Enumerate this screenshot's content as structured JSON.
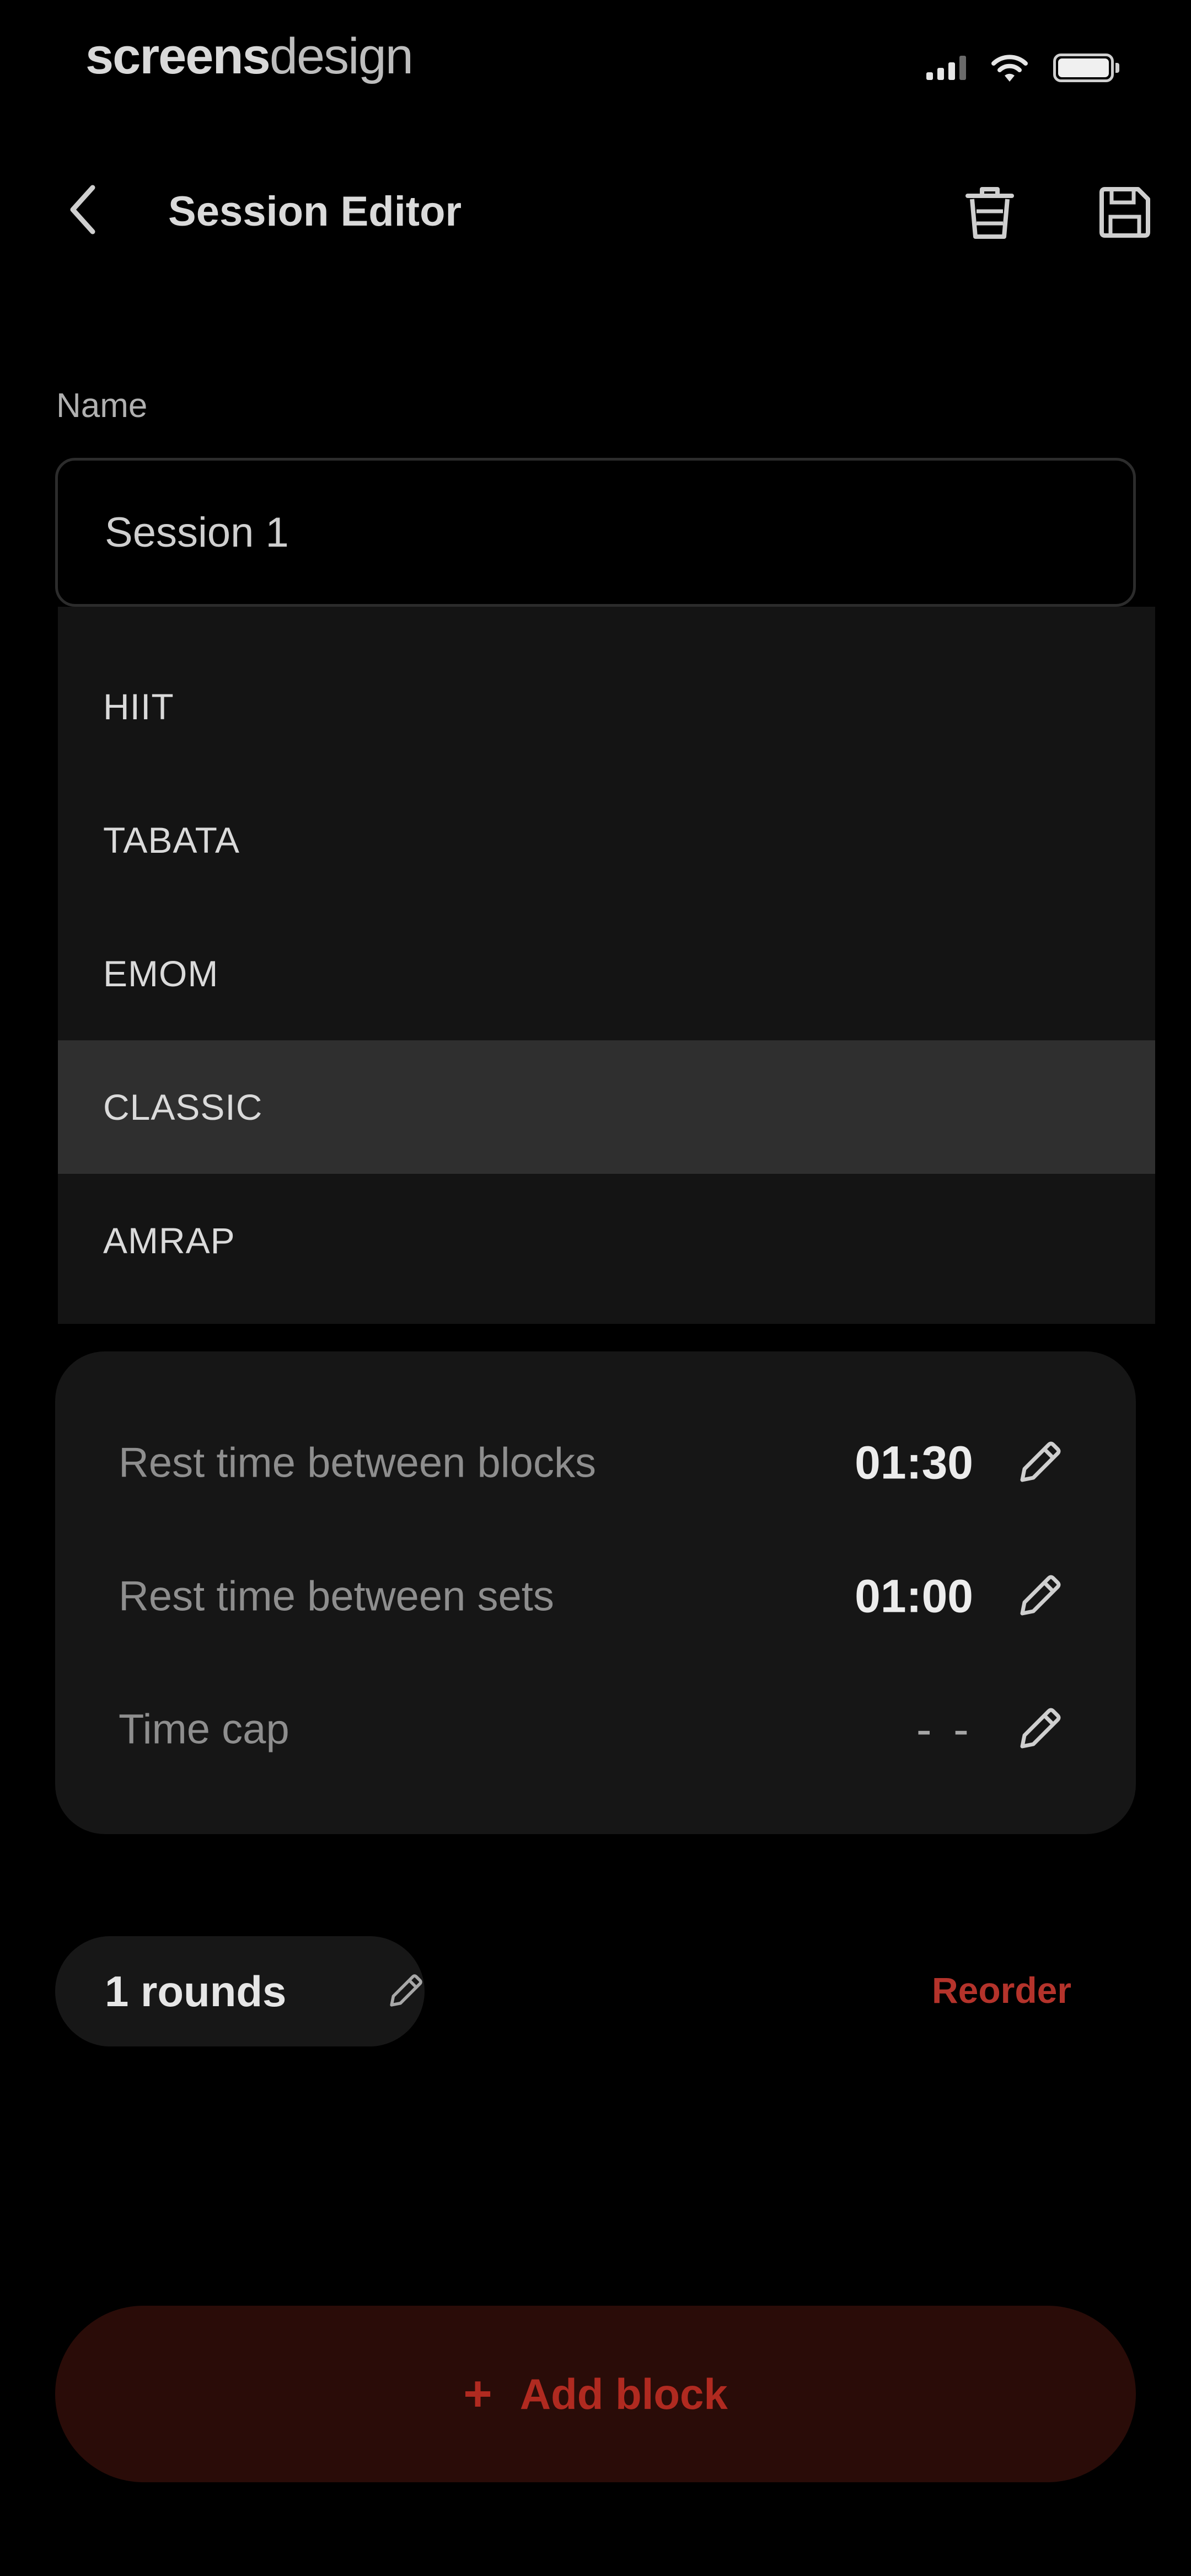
{
  "status_bar": {
    "carrier_bold": "screens",
    "carrier_light": "design",
    "icons": [
      "signal-icon",
      "wifi-icon",
      "battery-icon"
    ]
  },
  "header": {
    "title": "Session Editor",
    "icons": [
      "back-chevron-icon",
      "trash-icon",
      "save-icon"
    ]
  },
  "name_field": {
    "label": "Name",
    "value": "Session 1"
  },
  "workout_type_dropdown": {
    "options": [
      "HIIT",
      "TABATA",
      "EMOM",
      "CLASSIC",
      "AMRAP"
    ],
    "selected": "CLASSIC"
  },
  "settings": [
    {
      "label": "Rest time between blocks",
      "value": "01:30"
    },
    {
      "label": "Rest time between sets",
      "value": "01:00"
    },
    {
      "label": "Time cap",
      "value": "- -"
    }
  ],
  "rounds": {
    "label": "1 rounds"
  },
  "reorder_label": "Reorder",
  "add_block": {
    "plus": "+",
    "label": "Add block"
  },
  "colors": {
    "background": "#000000",
    "card": "#161616",
    "dropdown_bg": "#141414",
    "selected_option": "#2f2f2f",
    "accent": "#b02a20",
    "add_button_bg": "#2a0c08"
  }
}
